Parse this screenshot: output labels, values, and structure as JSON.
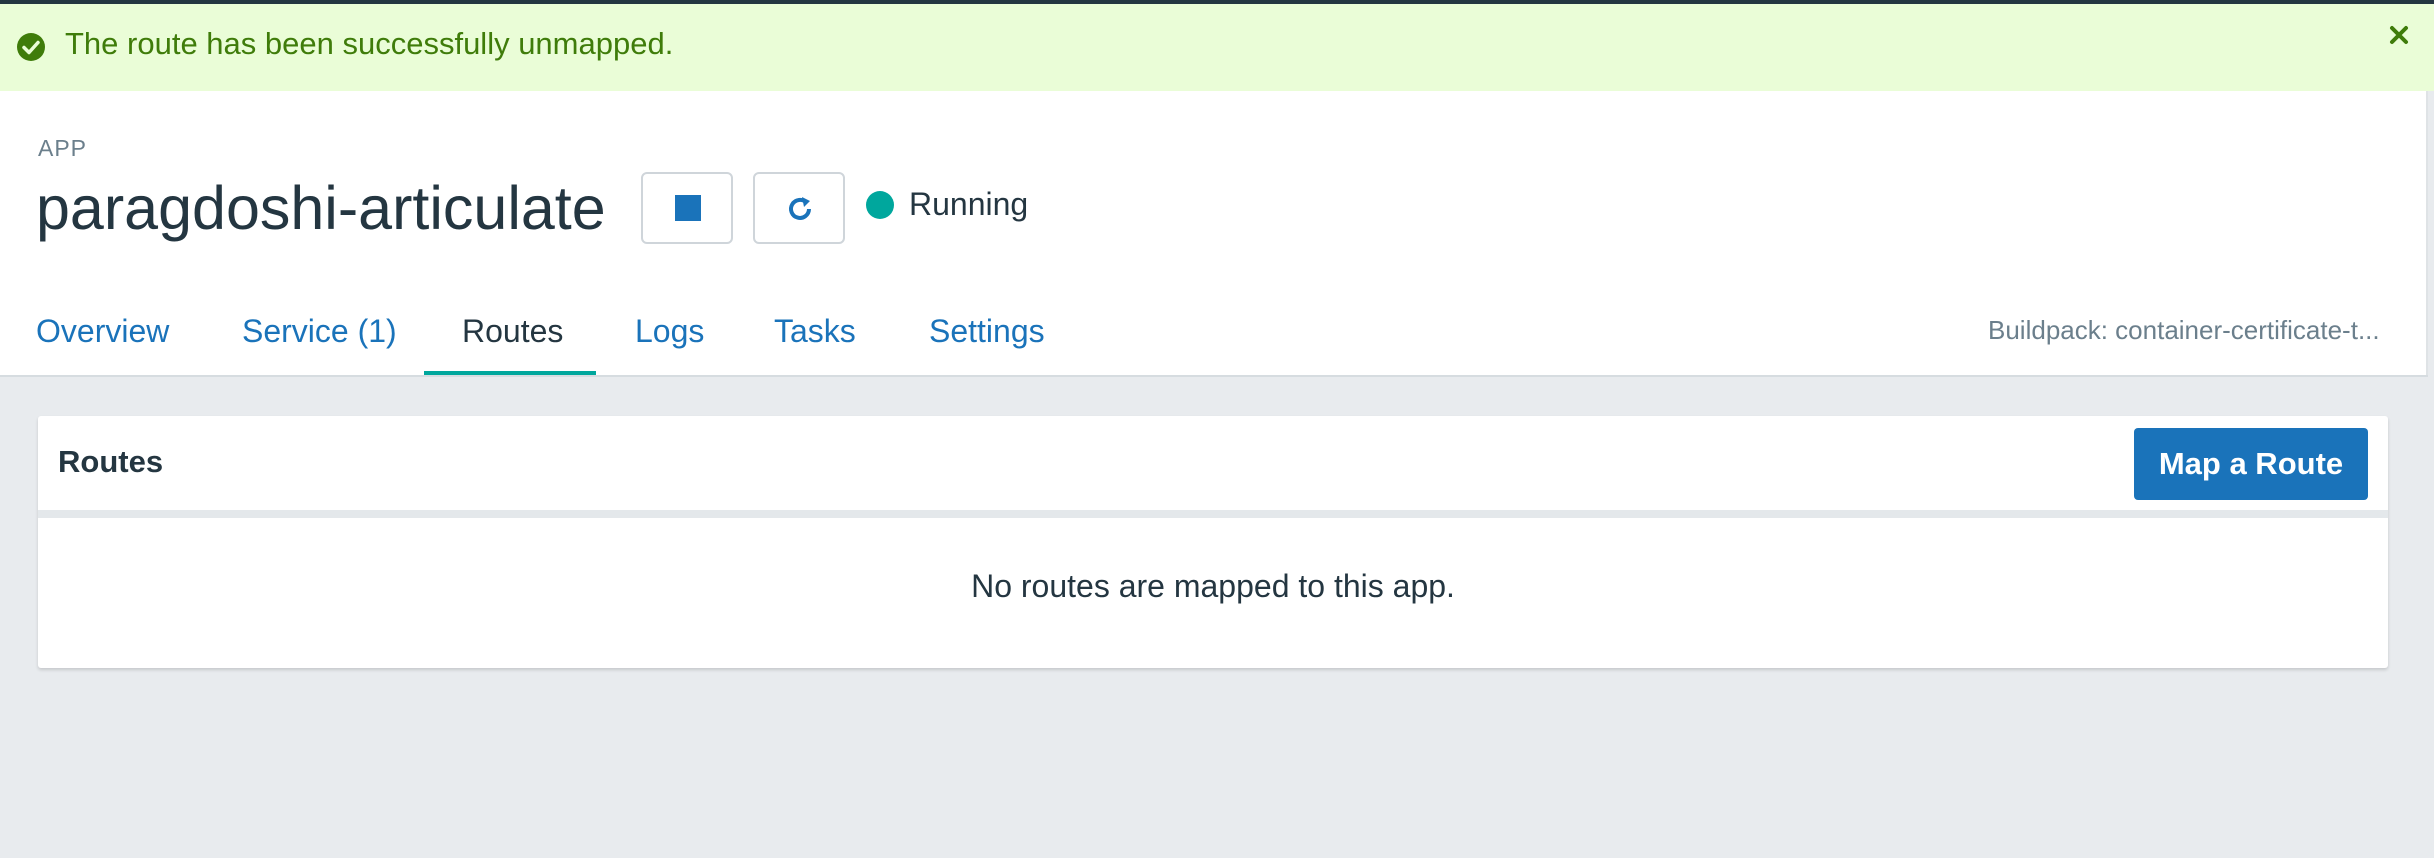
{
  "alert": {
    "message": "The route has been successfully unmapped.",
    "icon": "check-circle-icon",
    "close_icon": "close-icon",
    "color": "#3f7c0a",
    "background": "#eafdd7"
  },
  "app": {
    "label": "APP",
    "name": "paragdoshi-articulate",
    "status": "Running",
    "status_color": "#00a79d",
    "stop_icon": "stop-icon",
    "restart_icon": "restart-icon"
  },
  "tabs": [
    {
      "label": "Overview",
      "active": false
    },
    {
      "label": "Service (1)",
      "active": false
    },
    {
      "label": "Routes",
      "active": true
    },
    {
      "label": "Logs",
      "active": false
    },
    {
      "label": "Tasks",
      "active": false
    },
    {
      "label": "Settings",
      "active": false
    }
  ],
  "buildpack": "Buildpack: container-certificate-t...",
  "routes_card": {
    "title": "Routes",
    "map_button": "Map a Route",
    "empty_message": "No routes are mapped to this app."
  },
  "colors": {
    "link": "#1a73ba",
    "primary_button": "#1a73ba",
    "active_tab_underline": "#00a79d",
    "page_background": "#e8ebee"
  }
}
